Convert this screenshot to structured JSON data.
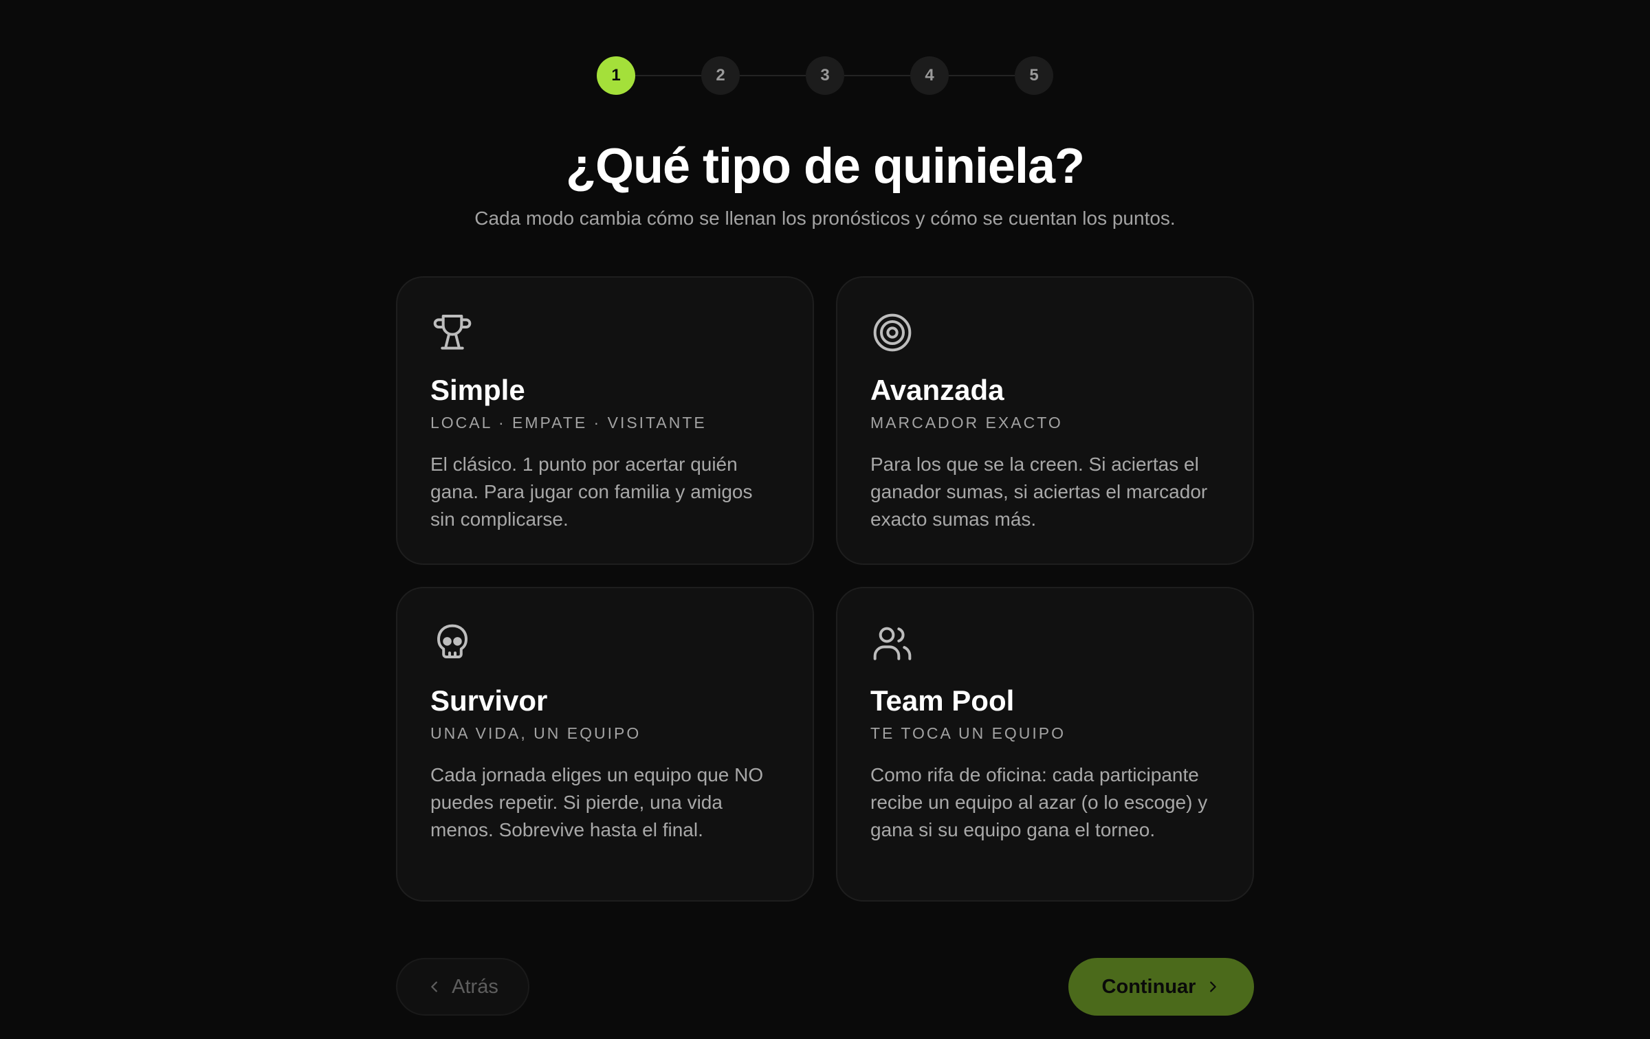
{
  "stepper": {
    "steps": [
      "1",
      "2",
      "3",
      "4",
      "5"
    ],
    "current_step": 1,
    "active_color": "#a4e03a"
  },
  "header": {
    "title": "¿Qué tipo de quiniela?",
    "subtitle": "Cada modo cambia cómo se llenan los pronósticos y cómo se cuentan los puntos."
  },
  "cards": [
    {
      "icon": "trophy-icon",
      "title": "Simple",
      "tag": "LOCAL · EMPATE · VISITANTE",
      "description": "El clásico. 1 punto por acertar quién gana. Para jugar con familia y amigos sin complicarse."
    },
    {
      "icon": "target-icon",
      "title": "Avanzada",
      "tag": "MARCADOR EXACTO",
      "description": "Para los que se la creen. Si aciertas el ganador sumas, si aciertas el marcador exacto sumas más."
    },
    {
      "icon": "skull-icon",
      "title": "Survivor",
      "tag": "UNA VIDA, UN EQUIPO",
      "description": "Cada jornada eliges un equipo que NO puedes repetir. Si pierde, una vida menos. Sobrevive hasta el final."
    },
    {
      "icon": "users-icon",
      "title": "Team Pool",
      "tag": "TE TOCA UN EQUIPO",
      "description": "Como rifa de oficina: cada participante recibe un equipo al azar (o lo escoge) y gana si su equipo gana el torneo."
    }
  ],
  "footer": {
    "back_label": "Atrás",
    "next_label": "Continuar",
    "next_color": "#4b6a1b"
  }
}
